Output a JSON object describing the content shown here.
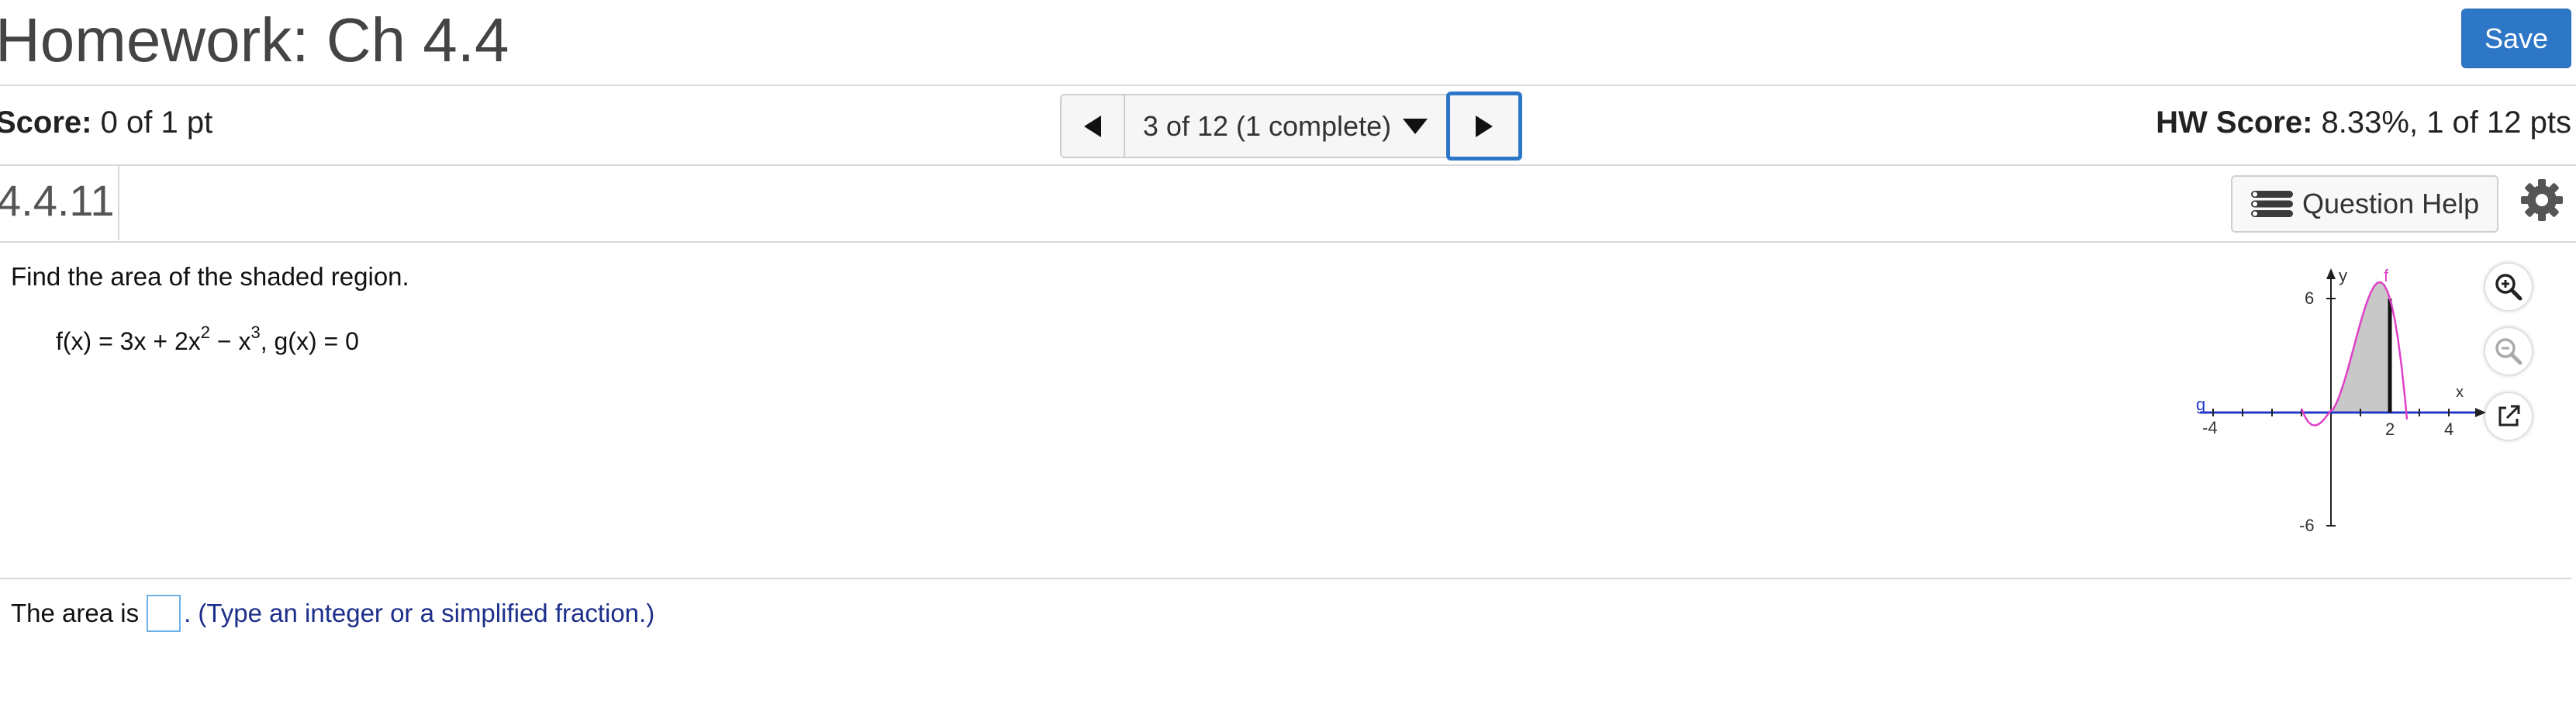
{
  "header": {
    "title": "Homework: Ch 4.4",
    "save_label": "Save"
  },
  "score": {
    "label": "Score:",
    "value": "0 of 1 pt"
  },
  "navigator": {
    "position": "3 of 12 (1 complete)"
  },
  "hw_score": {
    "label": "HW Score:",
    "value": "8.33%, 1 of 12 pts"
  },
  "question": {
    "number": "4.4.11",
    "help_label": "Question Help",
    "prompt": "Find the area of the shaded region.",
    "formula": {
      "f_prefix": "f(x) = 3x + 2x",
      "exp1": "2",
      "f_mid": " − x",
      "exp2": "3",
      "g_part": ", g(x) = 0"
    }
  },
  "graph": {
    "y_axis_label": "y",
    "x_axis_label": "x",
    "f_label": "f",
    "g_label": "g",
    "y_tick_top": "6",
    "y_tick_bottom": "-6",
    "x_tick_left": "-4",
    "x_tick_2": "2",
    "x_tick_4": "4",
    "f_color": "#e040c8",
    "g_color": "#2438c8",
    "shade_color": "#c8c8c8"
  },
  "tools": {
    "zoom_in": "zoom-in-icon",
    "zoom_out": "zoom-out-icon",
    "popout": "external-link-icon"
  },
  "answer": {
    "prefix": "The area is",
    "hint": ". (Type an integer or a simplified fraction.)"
  },
  "colors": {
    "accent": "#2e77c7",
    "hint_text": "#1d2f8a"
  }
}
